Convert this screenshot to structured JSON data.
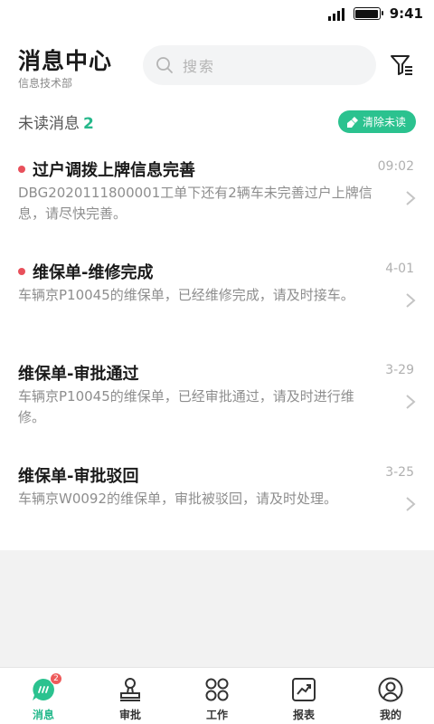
{
  "status_bar": {
    "time": "9:41"
  },
  "header": {
    "title": "消息中心",
    "subtitle": "信息技术部",
    "search_placeholder": "搜索"
  },
  "unread": {
    "label": "未读消息",
    "count": "2",
    "clear_label": "清除未读"
  },
  "messages": [
    {
      "title": "过户调拨上牌信息完善",
      "date": "09:02",
      "body": "DBG2020111800001工单下还有2辆车未完善过户上牌信息，请尽快完善。",
      "unread": true
    },
    {
      "title": "维保单-维修完成",
      "date": "4-01",
      "body": "车辆京P10045的维保单，已经维修完成，请及时接车。",
      "unread": true
    },
    {
      "title": "维保单-审批通过",
      "date": "3-29",
      "body": "车辆京P10045的维保单，已经审批通过，请及时进行维修。",
      "unread": false
    },
    {
      "title": "维保单-审批驳回",
      "date": "3-25",
      "body": "车辆京W0092的维保单，审批被驳回，请及时处理。",
      "unread": false
    }
  ],
  "tabbar": {
    "items": [
      {
        "label": "消息",
        "icon": "message-icon",
        "active": true,
        "badge": "2"
      },
      {
        "label": "审批",
        "icon": "stamp-icon",
        "active": false
      },
      {
        "label": "工作",
        "icon": "grid-icon",
        "active": false
      },
      {
        "label": "报表",
        "icon": "chart-icon",
        "active": false
      },
      {
        "label": "我的",
        "icon": "user-icon",
        "active": false
      }
    ]
  },
  "colors": {
    "accent": "#2bc28f",
    "unread_dot": "#e8505b"
  }
}
